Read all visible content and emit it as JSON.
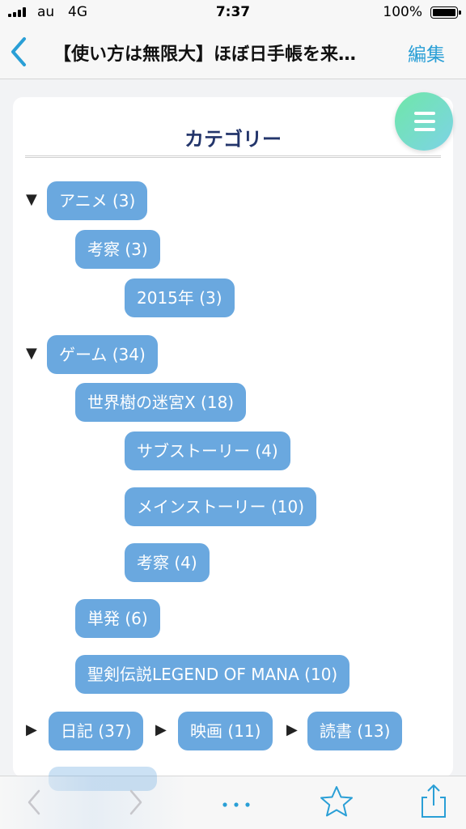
{
  "status_bar": {
    "carrier": "au",
    "network": "4G",
    "time": "7:37",
    "battery": "100%"
  },
  "nav": {
    "back_icon": "chevron-left-icon",
    "title": "【使い方は無限大】ほぼ日手帳を来…",
    "edit_label": "編集",
    "accent_color": "#2a9fd6"
  },
  "category_card": {
    "title": "カテゴリー",
    "tag_color": "#6aa8df",
    "menu_icon": "hamburger-icon",
    "tags": [
      "アニメ (3)",
      "考察 (3)",
      "2015年 (3)",
      "ゲーム (34)",
      "世界樹の迷宮X (18)",
      "サブストーリー (4)",
      "メインストーリー (10)",
      "考察 (4)",
      "単発 (6)",
      "聖剣伝説LEGEND OF MANA (10)",
      "日記 (37)",
      "映画 (11)",
      "読書 (13)"
    ],
    "arrows": {
      "expanded": "▼",
      "collapsed": "▶"
    }
  },
  "toolbar": {
    "items": [
      "back-icon",
      "forward-icon",
      "more-icon",
      "star-icon",
      "share-icon"
    ]
  }
}
